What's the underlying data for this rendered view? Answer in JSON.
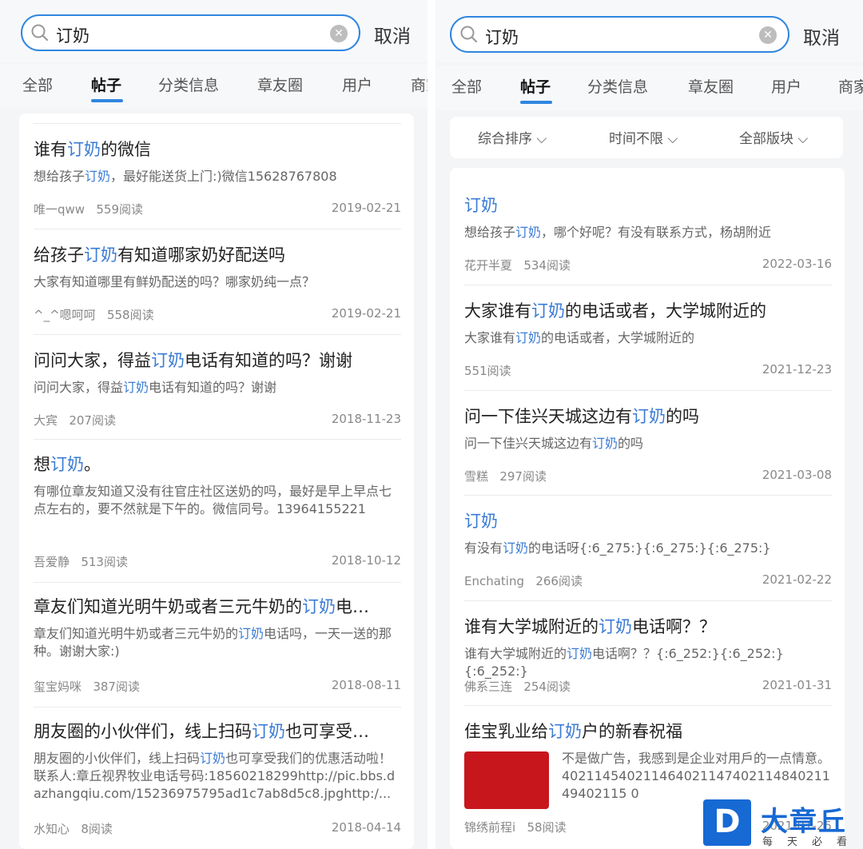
{
  "left": {
    "search": {
      "query": "订奶",
      "cancel_label": "取消"
    },
    "tabs": [
      "全部",
      "帖子",
      "分类信息",
      "章友圈",
      "用户",
      "商家"
    ],
    "posts": [
      {
        "title_pre": "谁有",
        "title_hl": "订奶",
        "title_post": "的微信",
        "body_pre": "想给孩子",
        "body_hl": "订奶",
        "body_post": "，最好能送货上门:)微信15628767808",
        "author": "唯一qww",
        "reads": "559阅读",
        "date": "2019-02-21"
      },
      {
        "title_pre": "给孩子",
        "title_hl": "订奶",
        "title_post": "有知道哪家奶好配送吗",
        "body_pre": "大家有知道哪里有鲜奶配送的吗？哪家奶纯一点？",
        "body_hl": "",
        "body_post": "",
        "author": "^_^嗯呵呵",
        "reads": "558阅读",
        "date": "2019-02-21"
      },
      {
        "title_pre": "问问大家，得益",
        "title_hl": "订奶",
        "title_post": "电话有知道的吗？谢谢",
        "body_pre": "问问大家，得益",
        "body_hl": "订奶",
        "body_post": "电话有知道的吗？谢谢",
        "author": "大宾",
        "reads": "207阅读",
        "date": "2018-11-23"
      },
      {
        "title_pre": "想",
        "title_hl": "订奶",
        "title_post": "。",
        "body_pre": "有哪位章友知道又没有往官庄社区送奶的吗，最好是早上早点七点左右的，要不然就是下午的。微信同号。13964155221",
        "body_hl": "",
        "body_post": "",
        "author": "吾爱静",
        "reads": "513阅读",
        "date": "2018-10-12"
      },
      {
        "title_pre": "章友们知道光明牛奶或者三元牛奶的",
        "title_hl": "订奶",
        "title_post": "电…",
        "body_pre": "章友们知道光明牛奶或者三元牛奶的",
        "body_hl": "订奶",
        "body_post": "电话吗，一天一送的那种。谢谢大家:)",
        "author": "玺宝妈咪",
        "reads": "387阅读",
        "date": "2018-08-11"
      },
      {
        "title_pre": "朋友圈的小伙伴们，线上扫码",
        "title_hl": "订奶",
        "title_post": "也可享受…",
        "body_pre": "朋友圈的小伙伴们，线上扫码",
        "body_hl": "订奶",
        "body_post": "也可享受我们的优惠活动啦！联系人:章丘视界牧业电话号码:18560218299http://pic.bbs.dazhangqiu.com/15236975795ad1c7ab8d5c8.jpghttp:/...",
        "author": "水知心",
        "reads": "8阅读",
        "date": "2018-04-14"
      }
    ]
  },
  "right": {
    "search": {
      "query": "订奶",
      "cancel_label": "取消"
    },
    "tabs": [
      "全部",
      "帖子",
      "分类信息",
      "章友圈",
      "用户",
      "商家"
    ],
    "filters": [
      "综合排序",
      "时间不限",
      "全部版块"
    ],
    "posts": [
      {
        "title_pre": "",
        "title_hl": "订奶",
        "title_post": "",
        "body_pre": "想给孩子",
        "body_hl": "订奶",
        "body_post": "，哪个好呢？有没有联系方式，杨胡附近",
        "author": "花开半夏",
        "reads": "534阅读",
        "date": "2022-03-16"
      },
      {
        "title_pre": "大家谁有",
        "title_hl": "订奶",
        "title_post": "的电话或者，大学城附近的",
        "body_pre": "大家谁有",
        "body_hl": "订奶",
        "body_post": "的电话或者，大学城附近的",
        "author": "",
        "reads": "551阅读",
        "date": "2021-12-23"
      },
      {
        "title_pre": "问一下佳兴天城这边有",
        "title_hl": "订奶",
        "title_post": "的吗",
        "body_pre": "问一下佳兴天城这边有",
        "body_hl": "订奶",
        "body_post": "的吗",
        "author": "雪糕",
        "reads": "297阅读",
        "date": "2021-03-08"
      },
      {
        "title_pre": "",
        "title_hl": "订奶",
        "title_post": "",
        "body_pre": "有没有",
        "body_hl": "订奶",
        "body_post": "的电话呀{:6_275:}{:6_275:}{:6_275:}",
        "author": "Enchating",
        "reads": "266阅读",
        "date": "2021-02-22"
      },
      {
        "title_pre": "谁有大学城附近的",
        "title_hl": "订奶",
        "title_post": "电话啊？？",
        "body_pre": "谁有大学城附近的",
        "body_hl": "订奶",
        "body_post": "电话啊？？{:6_252:}{:6_252:}{:6_252:}",
        "author": "佛系三连",
        "reads": "254阅读",
        "date": "2021-01-31"
      },
      {
        "title_pre": "佳宝乳业给",
        "title_hl": "订奶",
        "title_post": "户的新春祝福",
        "body_pre": "不是做广告，我感到是企业对用戶的一点情意。40211454021146402114740211484021149402115 0",
        "body_hl": "",
        "body_post": "",
        "author": "锦绣前程i",
        "reads": "58阅读",
        "date": "2021-01-25"
      }
    ]
  },
  "watermark": {
    "logo_letter": "D",
    "title": "大章丘",
    "subtitle": "每天必看"
  },
  "colors": {
    "accent": "#2f86e0",
    "highlight": "#3a7bd5",
    "logo": "#1769d4"
  }
}
